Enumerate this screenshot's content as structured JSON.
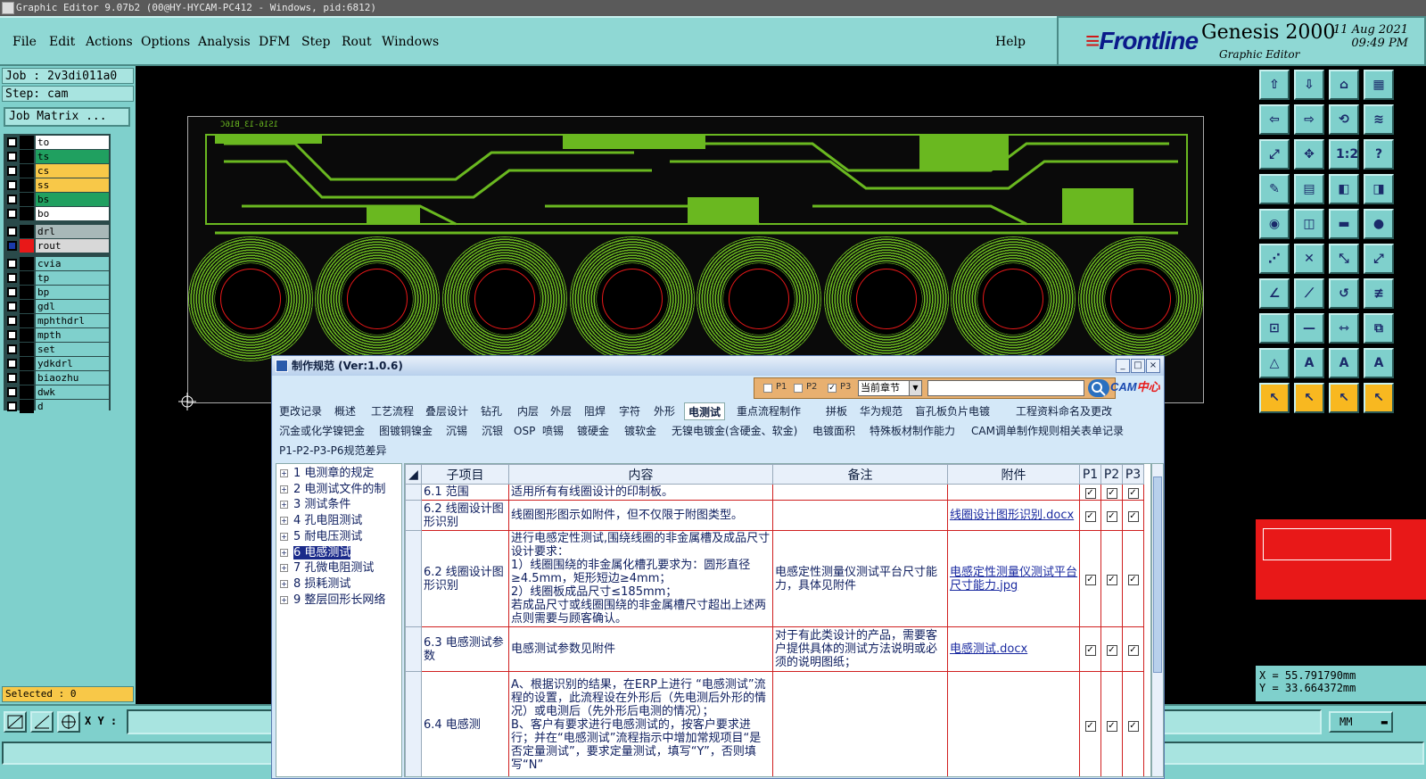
{
  "window": {
    "title": "Graphic Editor 9.07b2 (00@HY-HYCAM-PC412 - Windows, pid:6812)"
  },
  "menu": [
    "File",
    "Edit",
    "Actions",
    "Options",
    "Analysis",
    "DFM",
    "Step",
    "Rout",
    "Windows"
  ],
  "help_label": "Help",
  "logo": {
    "brand": "Frontline",
    "product": "Genesis 2000",
    "subtitle": "Graphic Editor",
    "date": "11 Aug 2021",
    "time": "09:49 PM"
  },
  "job": {
    "job_label": "Job : 2v3di011a0",
    "step_label": "Step: cam",
    "job_matrix_label": "Job Matrix ..."
  },
  "layers": [
    {
      "name": "to",
      "color": "#ffffff"
    },
    {
      "name": "ts",
      "color": "#20a060"
    },
    {
      "name": "cs",
      "color": "#f8c848"
    },
    {
      "name": "ss",
      "color": "#f8c848"
    },
    {
      "name": "bs",
      "color": "#20a060"
    },
    {
      "name": "bo",
      "color": "#ffffff"
    },
    {
      "name": "drl",
      "color": "#a8b8b8"
    },
    {
      "name": "rout",
      "color": "#d8d8d8"
    },
    {
      "name": "cvia",
      "color": "#7fd0cc"
    },
    {
      "name": "tp",
      "color": "#7fd0cc"
    },
    {
      "name": "bp",
      "color": "#7fd0cc"
    },
    {
      "name": "gdl",
      "color": "#7fd0cc"
    },
    {
      "name": "mphthdrl",
      "color": "#7fd0cc"
    },
    {
      "name": "mpth",
      "color": "#7fd0cc"
    },
    {
      "name": "set",
      "color": "#7fd0cc"
    },
    {
      "name": "ydkdrl",
      "color": "#7fd0cc"
    },
    {
      "name": "biaozhu",
      "color": "#7fd0cc"
    },
    {
      "name": "dwk",
      "color": "#7fd0cc"
    },
    {
      "name": "d",
      "color": "#7fd0cc"
    }
  ],
  "selected_label": "Selected : 0",
  "pcb_text": "1S16-13_B16C",
  "coords": {
    "x": "X = 55.791790mm",
    "y": "Y = 33.664372mm"
  },
  "xy_label": "X Y :",
  "units": "MM",
  "dialog": {
    "title": "制作规范 (Ver:1.0.6)",
    "filters": [
      "P1",
      "P2",
      "P3"
    ],
    "filter_checked": [
      false,
      false,
      true
    ],
    "chapter_select": "当前章节",
    "search_placeholder": "",
    "cam_logo_a": "CAM",
    "cam_logo_b": "中心",
    "tabs_row1": [
      "更改记录",
      "概述",
      "工艺流程",
      "叠层设计",
      "钻孔",
      "内层",
      "外层",
      "阻焊",
      "字符",
      "外形",
      "电测试",
      "重点流程制作",
      "拼板",
      "华为规范",
      "盲孔板负片电镀",
      "工程资料命名及更改"
    ],
    "tabs_row2": [
      "沉金或化学镍钯金",
      "图镀铜镍金",
      "沉锡",
      "沉银",
      "OSP",
      "喷锡",
      "镀硬金",
      "镀软金",
      "无镍电镀金(含硬金、软金)",
      "电镀面积",
      "特殊板材制作能力",
      "CAM调单制作规则",
      "相关表单记录"
    ],
    "tabs_row3": [
      "P1-P2-P3-P6规范差异"
    ],
    "active_tab": "电测试",
    "tree": [
      "1 电测章的规定",
      "2 电测试文件的制",
      "3 测试条件",
      "4 孔电阻测试",
      "5 耐电压测试",
      "6 电感测试",
      "7 孔微电阻测试",
      "8 损耗测试",
      "9 整层回形长网络"
    ],
    "tree_selected": 5,
    "columns": [
      "子项目",
      "内容",
      "备注",
      "附件",
      "P1",
      "P2",
      "P3"
    ],
    "rows": [
      {
        "sub": "6.1 范围",
        "content": "适用所有有线圈设计的印制板。",
        "note": "",
        "attach": "",
        "p": [
          true,
          true,
          true
        ]
      },
      {
        "sub": "6.2 线圈设计图形识别",
        "content": "线圈图形图示如附件，但不仅限于附图类型。",
        "note": "",
        "attach": "线圈设计图形识别.docx",
        "p": [
          true,
          true,
          true
        ]
      },
      {
        "sub": "6.2 线圈设计图形识别",
        "content": "进行电感定性测试,围绕线圈的非金属槽及成品尺寸设计要求：\n1）线圈围绕的非金属化槽孔要求为：圆形直径≥4.5mm，矩形短边≥4mm；\n2）线圈板成品尺寸≤185mm；\n若成品尺寸或线圈围绕的非金属槽尺寸超出上述两点则需要与顾客确认。",
        "note": "电感定性测量仪测试平台尺寸能力，具体见附件",
        "attach": "电感定性测量仪测试平台尺寸能力.jpg",
        "p": [
          true,
          true,
          true
        ]
      },
      {
        "sub": "6.3 电感测试参数",
        "content": "电感测试参数见附件",
        "note": "对于有此类设计的产品，需要客户提供具体的测试方法说明或必须的说明图纸；",
        "attach": "电感测试.docx",
        "p": [
          true,
          true,
          true
        ]
      },
      {
        "sub": "6.4 电感测",
        "content": "A、根据识别的结果，在ERP上进行 “电感测试”流程的设置，此流程设在外形后（先电测后外形的情况）或电测后（先外形后电测的情况）；\nB、客户有要求进行电感测试的，按客户要求进行；并在“电感测试”流程指示中增加常规项目“是否定量测试”，要求定量测试，填写“Y”，否则填写“N”",
        "note": "",
        "attach": "",
        "p": [
          true,
          true,
          true
        ]
      }
    ]
  }
}
